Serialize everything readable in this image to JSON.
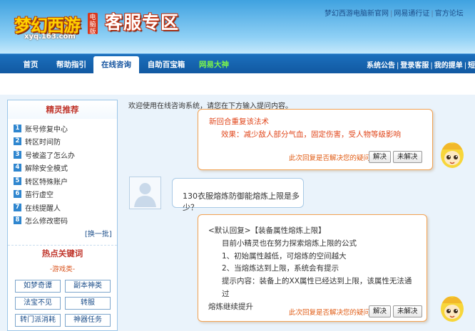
{
  "header": {
    "logo_text": "梦幻西游",
    "logo_badge": "电脑版",
    "logo_url": "xyq.163.com",
    "title": "客服专区",
    "links": [
      "梦幻西游电脑新官网",
      "网易通行证",
      "官方论坛"
    ]
  },
  "nav": {
    "tabs": [
      "首页",
      "帮助指引",
      "在线咨询",
      "自助百宝箱",
      "网易大神"
    ],
    "active_tab": "在线咨询",
    "right_links": [
      "系统公告",
      "登录客服",
      "我的提单",
      "短"
    ]
  },
  "sidebar": {
    "recommend_title": "精灵推荐",
    "items": [
      {
        "num": "1",
        "label": "账号修复中心"
      },
      {
        "num": "2",
        "label": "转区时间防"
      },
      {
        "num": "3",
        "label": "号被盗了怎么办"
      },
      {
        "num": "4",
        "label": "解除安全模式"
      },
      {
        "num": "5",
        "label": "转区特殊账户"
      },
      {
        "num": "6",
        "label": "苗行虚空"
      },
      {
        "num": "7",
        "label": "在线提醒人"
      },
      {
        "num": "8",
        "label": "怎么修改密码"
      }
    ],
    "more_label": "[换一批]",
    "hot_title": "热点关键词",
    "game_tag": "-游戏类-",
    "keywords": [
      "如梦奇谭",
      "副本神类",
      "法宝不见",
      "转服",
      "转门派消耗",
      "神器任务"
    ]
  },
  "main": {
    "welcome": "欢迎使用在线咨询系统，请您在下方输入提问内容。",
    "answer1": {
      "line1": "新回合重复该法术",
      "line2": "效果：减少敌人部分气血，固定伤害，受人物等级影响",
      "solved_prompt": "此次回复是否解决您的疑问:",
      "yes": "解决",
      "no": "未解决"
    },
    "question": "130衣服熔炼防御能熔炼上限是多少？",
    "answer2": {
      "lines": [
        "<默认回复>【装备属性熔炼上限】",
        "目前小精灵也在努力探索熔炼上限的公式",
        "1、初始属性越低，可熔炼的空间越大",
        "2、当熔炼达到上限，系统会有提示",
        "提示内容：装备上的XX属性已经达到上限，该属性无法通过",
        "熔炼继续提升"
      ],
      "solved_prompt": "此次回复是否解决您的疑问:",
      "yes": "解决",
      "no": "未解决"
    }
  }
}
